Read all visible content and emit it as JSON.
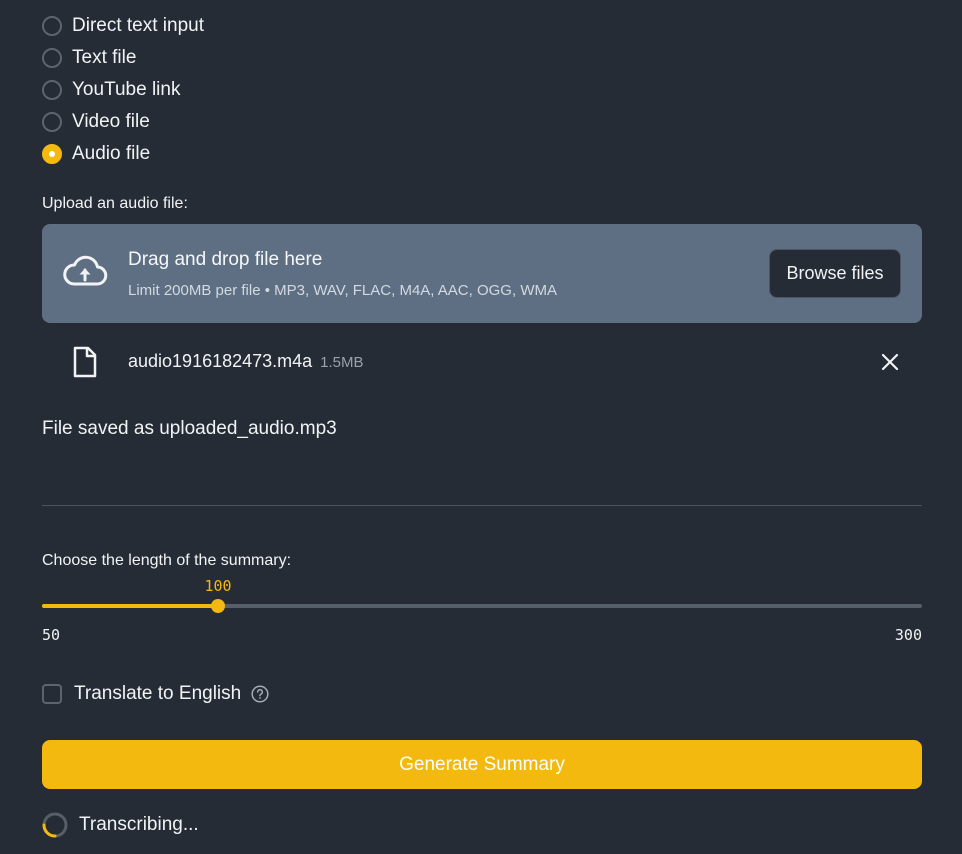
{
  "input_type": {
    "options": [
      {
        "label": "Direct text input",
        "selected": false
      },
      {
        "label": "Text file",
        "selected": false
      },
      {
        "label": "YouTube link",
        "selected": false
      },
      {
        "label": "Video file",
        "selected": false
      },
      {
        "label": "Audio file",
        "selected": true
      }
    ]
  },
  "uploader": {
    "label": "Upload an audio file:",
    "drop_title": "Drag and drop file here",
    "limit_text": "Limit 200MB per file • MP3, WAV, FLAC, M4A, AAC, OGG, WMA",
    "browse_label": "Browse files",
    "icon": "cloud-upload-icon"
  },
  "uploaded_file": {
    "name": "audio1916182473.m4a",
    "size": "1.5MB",
    "icon": "file-icon"
  },
  "saved_message": "File saved as uploaded_audio.mp3",
  "summary_length": {
    "label": "Choose the length of the summary:",
    "value": 100,
    "value_text": "100",
    "min": 50,
    "min_text": "50",
    "max": 300,
    "max_text": "300"
  },
  "translate": {
    "label": "Translate to English",
    "checked": false
  },
  "generate_label": "Generate Summary",
  "status_text": "Transcribing...",
  "colors": {
    "background": "#262c35",
    "accent": "#f3b90f",
    "dropzone": "#5e6f83"
  }
}
